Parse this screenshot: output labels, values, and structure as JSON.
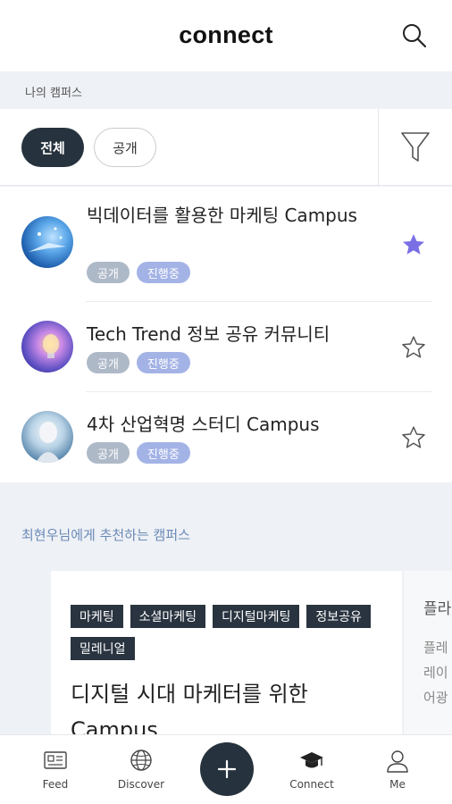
{
  "header": {
    "logo": "connect",
    "search_icon": "search-icon"
  },
  "section": {
    "my_campus": "나의 캠퍼스"
  },
  "filters": {
    "all": "전체",
    "public": "공개",
    "filter_icon": "funnel-icon"
  },
  "campuses": [
    {
      "title": "빅데이터를 활용한 마케팅 Campus",
      "badges": [
        "공개",
        "진행중"
      ],
      "favorite": true
    },
    {
      "title": "Tech Trend 정보 공유 커뮤니티",
      "badges": [
        "공개",
        "진행중"
      ],
      "favorite": false
    },
    {
      "title": "4차 산업혁명 스터디 Campus",
      "badges": [
        "공개",
        "진행중"
      ],
      "favorite": false
    }
  ],
  "recommend": {
    "label": "최현우님에게 추천하는 캠퍼스",
    "card": {
      "tags": [
        "마케팅",
        "소셜마케팅",
        "디지털마케팅",
        "정보공유",
        "밀레니얼"
      ],
      "title": "디지털 시대 마케터를 위한 Campus"
    },
    "card2": {
      "title": "플라",
      "lines": [
        "플레",
        "레이",
        "어광"
      ]
    }
  },
  "tabbar": {
    "feed": "Feed",
    "discover": "Discover",
    "add_icon": "plus-icon",
    "connect": "Connect",
    "me": "Me"
  },
  "colors": {
    "accent": "#26323d",
    "star": "#7b6fe6",
    "badge_public": "#aeb9c8",
    "badge_progress": "#a4b3e6",
    "link": "#6b8ab8"
  }
}
